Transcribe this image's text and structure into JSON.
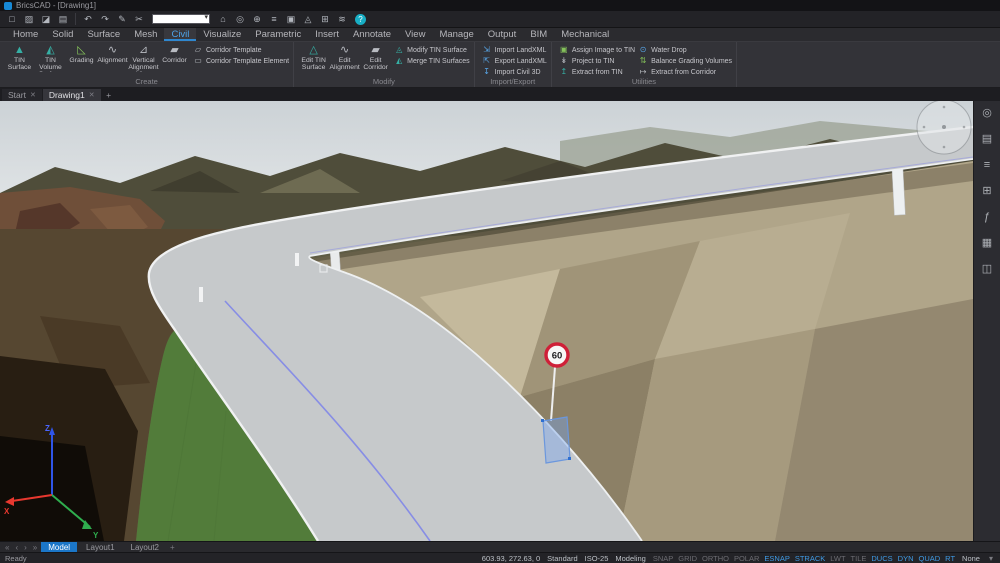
{
  "titlebar": {
    "app_title": "BricsCAD - [Drawing1]"
  },
  "quick_toolbar": {
    "icons_left": [
      "□",
      "▨",
      "◪",
      "▤",
      "↶",
      "↷",
      "✎",
      "✂"
    ],
    "dropdown_value": "",
    "dropdown_arrow": "▾",
    "icons_right": [
      "⌂",
      "◎",
      "⊕",
      "≡",
      "▣",
      "◬",
      "⊞",
      "≋"
    ],
    "help_glyph": "?"
  },
  "ribbon": {
    "tabs": [
      "Home",
      "Solid",
      "Surface",
      "Mesh",
      "Civil",
      "Visualize",
      "Parametric",
      "Insert",
      "Annotate",
      "View",
      "Manage",
      "Output",
      "BIM",
      "Mechanical"
    ],
    "create": {
      "label": "Create",
      "large": [
        {
          "label": "TIN Surface",
          "glyph": "▲"
        },
        {
          "label": "TIN Volume Surface",
          "glyph": "◭"
        },
        {
          "label": "Grading",
          "glyph": "◺"
        },
        {
          "label": "Alignment",
          "glyph": "∿"
        },
        {
          "label": "Vertical Alignment View",
          "glyph": "⊿"
        },
        {
          "label": "Corridor",
          "glyph": "▰"
        }
      ],
      "stack": [
        {
          "label": "Corridor Template",
          "glyph": "▱"
        },
        {
          "label": "Corridor Template Element",
          "glyph": "▭"
        }
      ]
    },
    "modify": {
      "label": "Modify",
      "large": [
        {
          "label": "Edit TIN Surface",
          "glyph": "△"
        },
        {
          "label": "Edit Alignment",
          "glyph": "∿"
        },
        {
          "label": "Edit Corridor",
          "glyph": "▰"
        }
      ],
      "stack": [
        {
          "label": "Modify TIN Surface",
          "glyph": "◬"
        },
        {
          "label": "Merge TIN Surfaces",
          "glyph": "◭"
        }
      ]
    },
    "importexport": {
      "label": "Import/Export",
      "stack": [
        {
          "label": "Import LandXML",
          "glyph": "⇲"
        },
        {
          "label": "Export LandXML",
          "glyph": "⇱"
        },
        {
          "label": "Import Civil 3D",
          "glyph": "↧"
        }
      ]
    },
    "utilities": {
      "label": "Utilities",
      "stack_a": [
        {
          "label": "Assign Image to TIN",
          "glyph": "▣"
        },
        {
          "label": "Project to TIN",
          "glyph": "↡"
        },
        {
          "label": "Extract from TIN",
          "glyph": "↥"
        }
      ],
      "stack_b": [
        {
          "label": "Water Drop",
          "glyph": "⊙"
        },
        {
          "label": "Balance Grading Volumes",
          "glyph": "⇅"
        },
        {
          "label": "Extract from Corridor",
          "glyph": "↦"
        }
      ]
    }
  },
  "doc_tabs": {
    "tabs": [
      {
        "label": "Start"
      },
      {
        "label": "Drawing1"
      }
    ],
    "close_glyph": "✕",
    "add_glyph": "+"
  },
  "viewport": {
    "speed_limit": "60",
    "axis_x": "X",
    "axis_y": "Y",
    "axis_z": "Z"
  },
  "sidebar_icons": [
    "◎",
    "▤",
    "≡",
    "⊞",
    "ƒ",
    "▦",
    "◫"
  ],
  "layoutbar": {
    "nav": [
      "«",
      "‹",
      "›",
      "»"
    ],
    "tabs": [
      {
        "label": "Model"
      },
      {
        "label": "Layout1"
      },
      {
        "label": "Layout2"
      }
    ],
    "add_glyph": "+"
  },
  "statusbar": {
    "ready": "Ready",
    "coords": "603.93, 272.63, 0",
    "standard": "Standard",
    "dimstyle": "ISO-25",
    "workspace": "Modeling",
    "toggles": [
      {
        "label": "SNAP",
        "on": false
      },
      {
        "label": "GRID",
        "on": false
      },
      {
        "label": "ORTHO",
        "on": false
      },
      {
        "label": "POLAR",
        "on": false
      },
      {
        "label": "ESNAP",
        "on": true
      },
      {
        "label": "STRACK",
        "on": true
      },
      {
        "label": "LWT",
        "on": false
      },
      {
        "label": "TILE",
        "on": false
      },
      {
        "label": "DUCS",
        "on": true
      },
      {
        "label": "DYN",
        "on": true
      },
      {
        "label": "QUAD",
        "on": true
      },
      {
        "label": "RT",
        "on": true
      }
    ],
    "selection": "None",
    "expander": "▾"
  },
  "colors": {
    "accent": "#2f87cf",
    "model_tab": "#1b76c8",
    "speed_ring": "#cf2038",
    "green_slope": "#6ea04f"
  }
}
